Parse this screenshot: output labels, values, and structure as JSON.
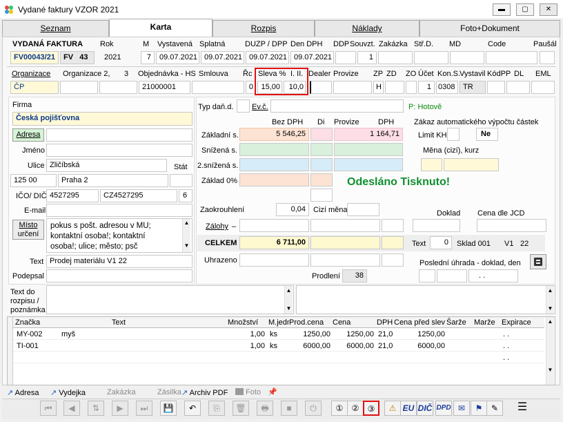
{
  "window": {
    "title": "Vydané faktury VZOR  2021",
    "min": "▬",
    "max": "▢",
    "close": "✕"
  },
  "tabs": [
    "Seznam",
    "Karta",
    "Rozpis",
    "Náklady",
    "Foto+Dokument"
  ],
  "head": {
    "labels": {
      "vydana": "VYDANÁ FAKTURA",
      "rok": "Rok",
      "m": "M",
      "vystavena": "Vystavená",
      "splatna": "Splatná",
      "duzp": "DUZP / DPP",
      "dendph": "Den DPH",
      "ddp": "DDP",
      "souvzt": "Souvzt.",
      "zakazka": "Zakázka",
      "strd": "Stř.D.",
      "md": "MD",
      "code": "Code",
      "pausal": "Paušál"
    },
    "number": "FV00043/21",
    "fv": "FV",
    "fvnum": "43",
    "rok": "2021",
    "m": "7",
    "vystavena": "09.07.2021",
    "splatna": "09.07.2021",
    "duzp": "09.07.2021",
    "dendph": "09.07.2021",
    "souvzt": "1"
  },
  "org": {
    "labels": {
      "organizace": "Organizace",
      "organizace2": "Organizace 2,",
      "three": "3",
      "objednavka": "Objednávka - HS",
      "smlouva": "Smlouva",
      "rc": "Řc",
      "sleva": "Sleva %",
      "sleva2": "I.  II.",
      "dealer": "Dealer",
      "provize": "Provize",
      "zp": "ZP",
      "zd": "ZD",
      "zo": "ZO",
      "ucet": "Účet",
      "kons": "Kon.S.",
      "vystavil": "Vystavil",
      "kodpp": "KódPP",
      "dl": "DL",
      "eml": "EML"
    },
    "cp": "ČP",
    "objednavka": "21000001",
    "rc": "0",
    "sleva1": "15,00",
    "sleva2": "10,0",
    "zd": "H",
    "ucet": "1",
    "kons": "0308",
    "vystavil": "TR"
  },
  "firm": {
    "firma_label": "Firma",
    "firma": "Česká pojišťovna",
    "adresa_btn": "Adresa",
    "jmeno_label": "Jméno",
    "ulice_label": "Ulice",
    "ulice": "Zličíbská",
    "stat_label": "Stát",
    "psc": "125 00",
    "mesto": "Praha 2",
    "ico_label": "IČO/ DIČ",
    "ico": "4527295",
    "dic": "CZ4527295",
    "ico_n": "6",
    "email_label": "E-mail",
    "misto_btn1": "Místo",
    "misto_btn2": "určení",
    "misto_text": [
      "pokus s pošt. adresou v MU;",
      "kontaktní osoba!; kontaktní",
      "osoba!; ulice; město; psč"
    ],
    "text_label": "Text",
    "text": "Prodej materiálu V1  22",
    "podepsal_label": "Podepsal"
  },
  "calc": {
    "typdan_label": "Typ daň.d.",
    "evc_label": "Ev.č.",
    "payment": "P: Hotově",
    "hdr_bezdph": "Bez DPH",
    "hdr_di": "Di",
    "hdr_provize": "Provize",
    "hdr_dph": "DPH",
    "zakladni_label": "Základní s.",
    "zakladni": "5 546,25",
    "zakladni_provize": "1 164,71",
    "snizena_label": "Snížená s.",
    "snizena2_label": "2.snížená s.",
    "zaklad0_label": "Základ 0%",
    "zaokrouhleni_label": "Zaokrouhlení",
    "zaokrouhleni": "0,04",
    "cizimena_label": "Cizí měna",
    "zalohy_label": "Zálohy",
    "zalohy_dash": "–",
    "celkem_label": "CELKEM",
    "celkem": "6 711,00",
    "uhrazeno_label": "Uhrazeno",
    "prodleni_label": "Prodlení",
    "prodleni": "38",
    "zakaz_label": "Zákaz automatického výpočtu částek",
    "limit_label": "Limit KH",
    "ne": "Ne",
    "mena_label": "Měna (cizí), kurz",
    "status": "Odesláno Tisknuto!",
    "doklad_label": "Doklad",
    "cena_jcd_label": "Cena dle JCD",
    "text_label": "Text",
    "text_val": "0",
    "sklad": "Sklad 001",
    "v1": "V1",
    "v1n": "22",
    "posledni_label": "Poslední úhrada - doklad, den",
    "dots": ". ."
  },
  "rozpis_label": [
    "Text do",
    "rozpisu /",
    "poznámka"
  ],
  "table": {
    "headers": [
      "Značka",
      "Text",
      "Množství",
      "M.jedn",
      "Prod.cena",
      "Cena",
      "DPH",
      "Cena před slev",
      "Šarže",
      "Marže",
      "Expirace"
    ],
    "rows": [
      [
        "MY-002",
        "myš",
        "1,00",
        "ks",
        "1250,00",
        "1250,00",
        "21,0",
        "1250,00",
        "",
        "",
        ". ."
      ],
      [
        "TI-001",
        "",
        "1,00",
        "ks",
        "6000,00",
        "6000,00",
        "21,0",
        "6000,00",
        "",
        "",
        ". ."
      ],
      [
        "",
        "",
        "",
        "",
        "",
        "",
        "",
        "",
        "",
        "",
        ". ."
      ]
    ]
  },
  "links": {
    "adresa": "Adresa",
    "vydejka": "Vydejka",
    "zakazka": "Zakázka",
    "zasilka": "Zásilka",
    "archiv": "Archiv PDF",
    "foto": "Foto"
  },
  "toolbar": {
    "eu": "EU",
    "dic": "DIČ",
    "dpd": "DPD",
    "menu": "☰"
  }
}
